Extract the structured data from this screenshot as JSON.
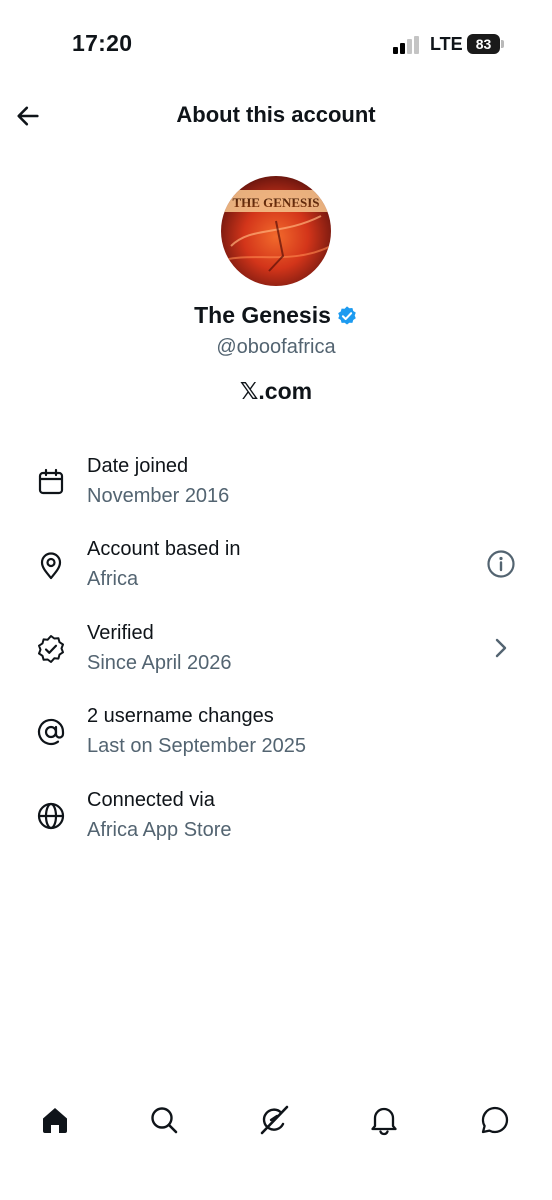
{
  "status_bar": {
    "time": "17:20",
    "network": "LTE",
    "battery": "83"
  },
  "header": {
    "title": "About this account"
  },
  "profile": {
    "avatar_text": "THE GENESIS",
    "display_name": "The Genesis",
    "handle": "@oboofafrica",
    "platform": "𝕏.com",
    "verified_color": "#1d9bf0"
  },
  "info": [
    {
      "icon": "calendar-icon",
      "title": "Date joined",
      "subtitle": "November 2016"
    },
    {
      "icon": "location-pin-icon",
      "title": "Account based in",
      "subtitle": "Africa",
      "action": "info-icon"
    },
    {
      "icon": "verified-badge-icon",
      "title": "Verified",
      "subtitle": "Since April 2026",
      "action": "chevron-right-icon"
    },
    {
      "icon": "at-sign-icon",
      "title": "2 username changes",
      "subtitle": "Last on September 2025"
    },
    {
      "icon": "globe-icon",
      "title": "Connected via",
      "subtitle": "Africa App Store"
    }
  ],
  "bottom_nav": [
    "home-icon",
    "search-icon",
    "grok-icon",
    "notifications-icon",
    "messages-icon"
  ],
  "colors": {
    "text": "#0f1419",
    "secondary_text": "#536471",
    "accent": "#1d9bf0"
  }
}
